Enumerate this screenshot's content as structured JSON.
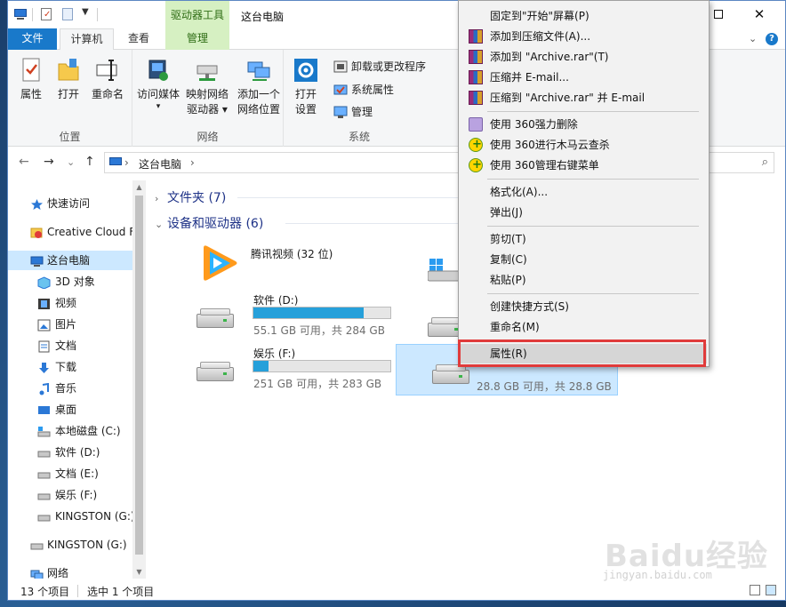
{
  "window": {
    "title": "这台电脑",
    "contextual_tab_group": "驱动器工具",
    "buttons": {
      "maximize": "☐",
      "close": "✕"
    }
  },
  "ribbon_tabs": {
    "file": "文件",
    "computer": "计算机",
    "view": "查看",
    "manage": "管理",
    "chevron": "⌄",
    "help": "?"
  },
  "ribbon": {
    "location": {
      "label": "位置",
      "properties": "属性",
      "open": "打开",
      "rename": "重命名"
    },
    "network": {
      "label": "网络",
      "access_media": [
        "访问媒体",
        "▾"
      ],
      "map_drive": [
        "映射网络",
        "驱动器 ▾"
      ],
      "add_location": [
        "添加一个",
        "网络位置"
      ]
    },
    "system": {
      "label": "系统",
      "open_settings": [
        "打开",
        "设置"
      ],
      "uninstall": "卸载或更改程序",
      "sys_props": "系统属性",
      "manage": "管理"
    }
  },
  "address": {
    "path": "这台电脑",
    "separator": "›",
    "nav_back": "←",
    "nav_forward": "→",
    "nav_dropdown": "⌄",
    "nav_up": "↑",
    "search_icon": "⌕"
  },
  "nav_pane": {
    "items": [
      {
        "label": "快速访问",
        "icon": "star-icon"
      },
      {
        "label": "Creative Cloud Files",
        "icon": "creative-cloud-icon"
      },
      {
        "label": "这台电脑",
        "icon": "computer-icon",
        "selected": true
      },
      {
        "label": "3D 对象",
        "icon": "cube-icon"
      },
      {
        "label": "视频",
        "icon": "video-icon"
      },
      {
        "label": "图片",
        "icon": "picture-icon"
      },
      {
        "label": "文档",
        "icon": "document-icon"
      },
      {
        "label": "下载",
        "icon": "download-icon"
      },
      {
        "label": "音乐",
        "icon": "music-icon"
      },
      {
        "label": "桌面",
        "icon": "desktop-icon"
      },
      {
        "label": "本地磁盘 (C:)",
        "icon": "windows-drive-icon"
      },
      {
        "label": "软件 (D:)",
        "icon": "drive-icon"
      },
      {
        "label": "文档 (E:)",
        "icon": "drive-icon"
      },
      {
        "label": "娱乐 (F:)",
        "icon": "drive-icon"
      },
      {
        "label": "KINGSTON (G:)",
        "icon": "usb-drive-icon"
      },
      {
        "label": "KINGSTON (G:)",
        "icon": "usb-drive-icon"
      },
      {
        "label": "网络",
        "icon": "network-icon"
      }
    ]
  },
  "content": {
    "sections": {
      "folders": "文件夹 (7)",
      "devices": "设备和驱动器 (6)"
    },
    "section_chevrons": {
      "collapsed": "›",
      "expanded": "⌄"
    },
    "tencent_video": "腾讯视频 (32 位)",
    "drives": [
      {
        "name": "软件 (D:)",
        "free": "55.1 GB 可用，共 284 GB",
        "used_fraction": 0.806
      },
      {
        "name": "娱乐 (F:)",
        "free": "251 GB 可用，共 283 GB",
        "used_fraction": 0.113
      },
      {
        "name": "",
        "free": "28.8 GB 可用，共 28.8 GB",
        "used_fraction": 0.0,
        "selected": true
      }
    ]
  },
  "status_bar": {
    "count": "13 个项目",
    "selection": "选中 1 个项目"
  },
  "context_menu": {
    "items": [
      {
        "label": "固定到\"开始\"屏幕(P)",
        "icon": ""
      },
      {
        "label": "添加到压缩文件(A)...",
        "icon": "winrar-icon"
      },
      {
        "label": "添加到 \"Archive.rar\"(T)",
        "icon": "winrar-icon"
      },
      {
        "label": "压缩并 E-mail...",
        "icon": "winrar-icon"
      },
      {
        "label": "压缩到 \"Archive.rar\" 并 E-mail",
        "icon": "winrar-icon"
      },
      {
        "label": "使用 360强力删除",
        "icon": "shredder-icon"
      },
      {
        "label": "使用 360进行木马云查杀",
        "icon": "360-icon"
      },
      {
        "label": "使用 360管理右键菜单",
        "icon": "360-icon"
      },
      {
        "label": "格式化(A)...",
        "icon": ""
      },
      {
        "label": "弹出(J)",
        "icon": ""
      },
      {
        "label": "剪切(T)",
        "icon": ""
      },
      {
        "label": "复制(C)",
        "icon": ""
      },
      {
        "label": "粘贴(P)",
        "icon": ""
      },
      {
        "label": "创建快捷方式(S)",
        "icon": ""
      },
      {
        "label": "重命名(M)",
        "icon": ""
      },
      {
        "label": "属性(R)",
        "icon": "",
        "highlighted": true
      }
    ]
  },
  "watermark": {
    "logo": "Baidu经验",
    "url": "jingyan.baidu.com"
  },
  "colors": {
    "accent": "#1979ca",
    "manage_tab_bg": "#d6f0c2",
    "selection_bg": "#cce8ff",
    "progress_fill": "#26a0da",
    "highlight_border": "#e03b3b"
  }
}
